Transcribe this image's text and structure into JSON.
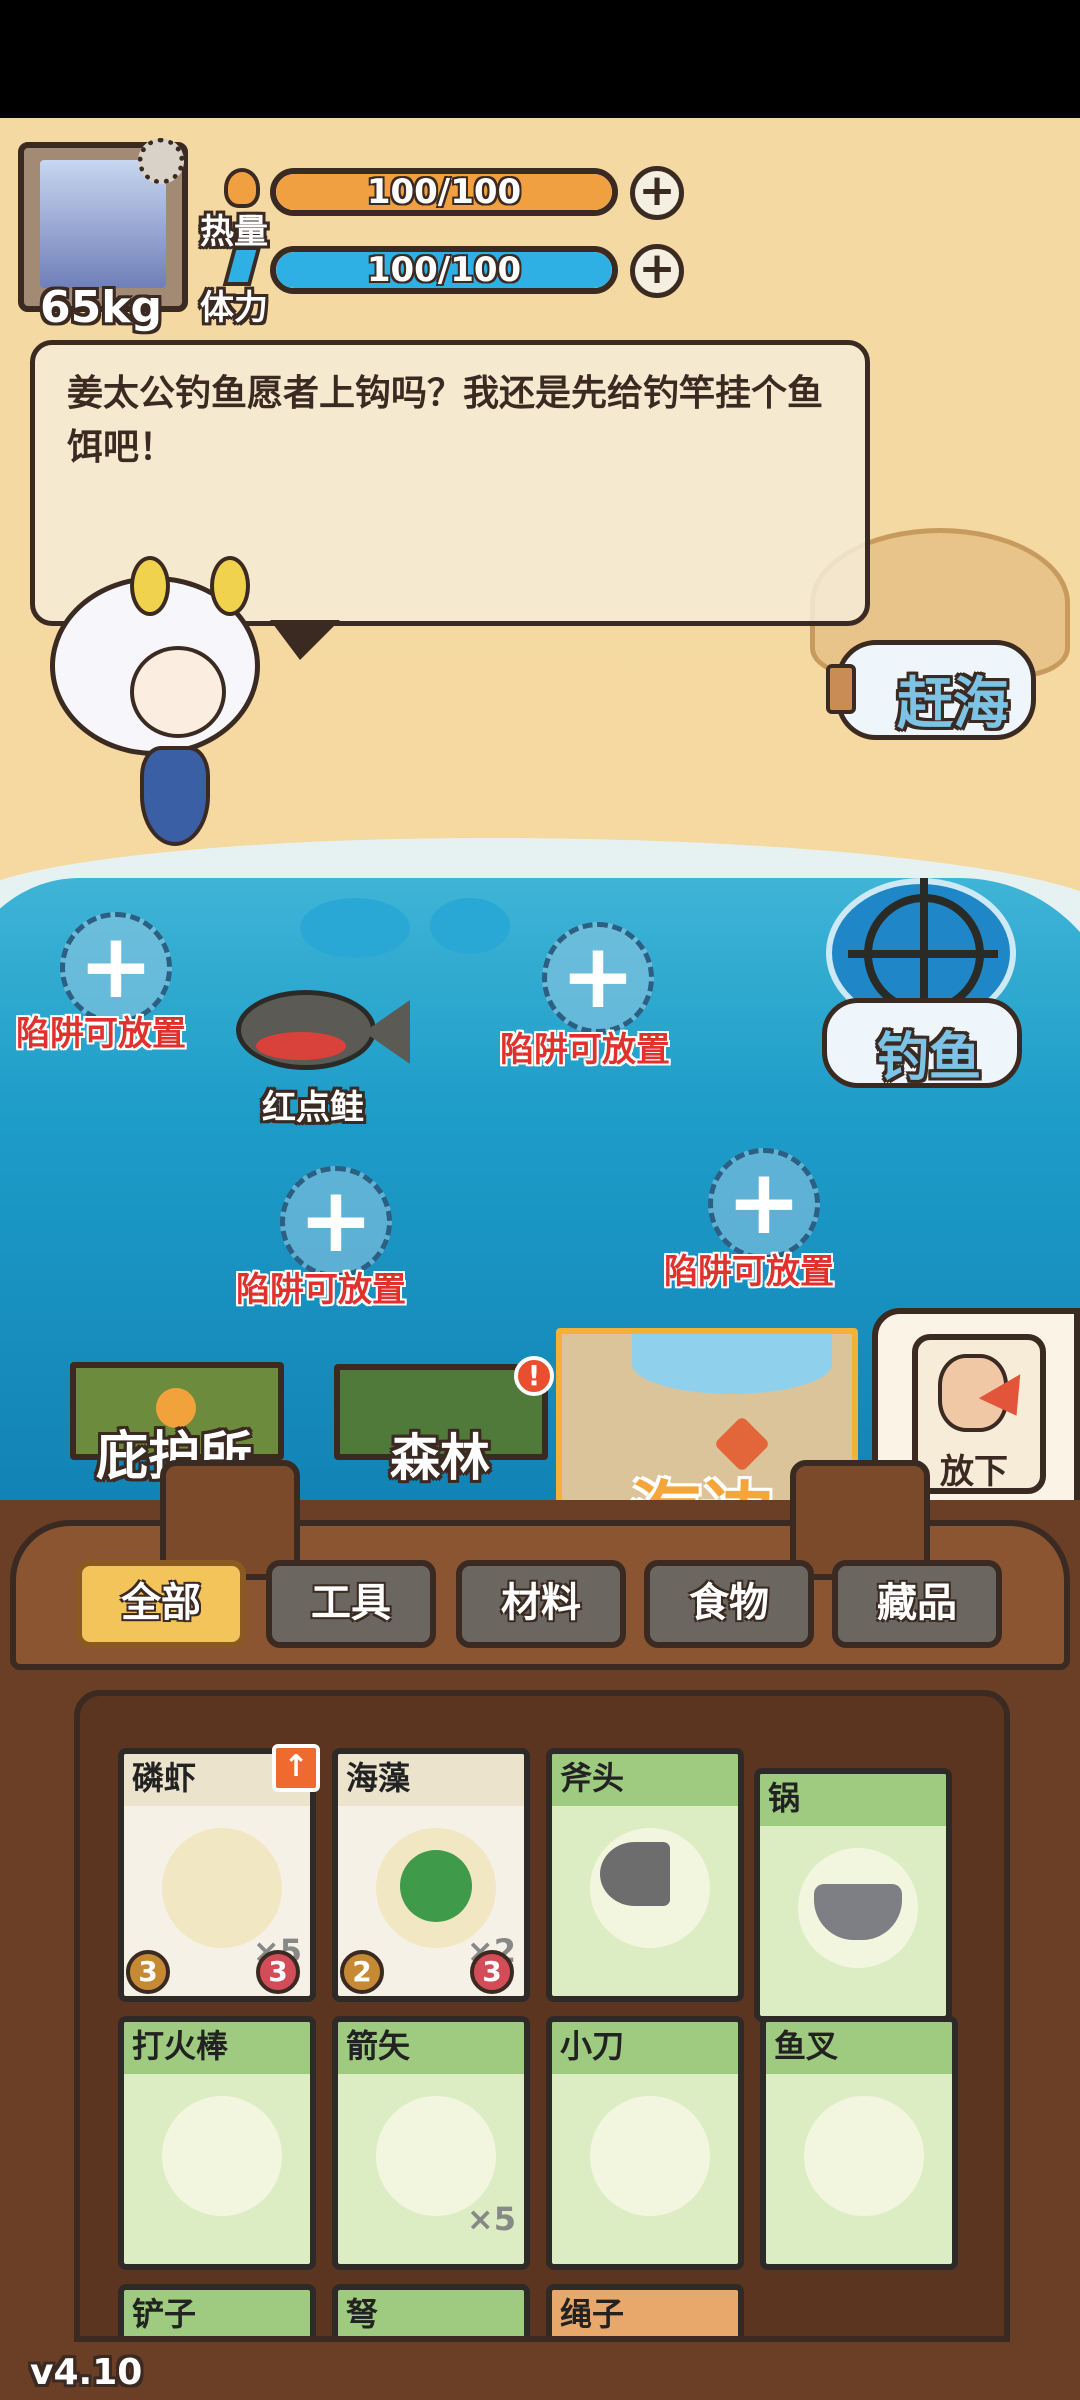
{
  "player": {
    "weight": "65kg",
    "heat_label": "热量",
    "heat_value": "100/100",
    "heat_fraction": 1.0,
    "stamina_label": "体力",
    "stamina_value": "100/100",
    "stamina_fraction": 1.0
  },
  "dialog": {
    "text": "姜太公钓鱼愿者上钩吗？我还是先给钓竿挂个鱼饵吧！"
  },
  "actions": {
    "gather_label": "赶海",
    "fishing_label": "钓鱼",
    "put_down_label": "放下"
  },
  "traps": {
    "slot_label": "陷阱可放置",
    "plus": "+"
  },
  "fish": {
    "name": "红点鲑"
  },
  "locations": [
    {
      "label": "庇护所"
    },
    {
      "label": "森林",
      "alert": "!"
    },
    {
      "label": "海边"
    }
  ],
  "categories": [
    "全部",
    "工具",
    "材料",
    "食物",
    "藏品"
  ],
  "items": [
    {
      "name": "磷虾",
      "qty": "×5",
      "badge_left": "3",
      "badge_right": "3",
      "upgrade": "↑"
    },
    {
      "name": "海藻",
      "qty": "×2",
      "badge_left": "2",
      "badge_right": "3"
    },
    {
      "name": "斧头"
    },
    {
      "name": "锅"
    },
    {
      "name": "打火棒"
    },
    {
      "name": "箭矢",
      "qty": "×5"
    },
    {
      "name": "小刀"
    },
    {
      "name": "鱼叉"
    },
    {
      "name": "铲子"
    },
    {
      "name": "弩"
    },
    {
      "name": "绳子"
    }
  ],
  "version": "v4.10",
  "colors": {
    "heat": "#f0a040",
    "stamina": "#2fb0e4",
    "tool_card": "#9ecb7f",
    "active_tab": "#f2c45a",
    "trap_text": "#e0312c"
  }
}
